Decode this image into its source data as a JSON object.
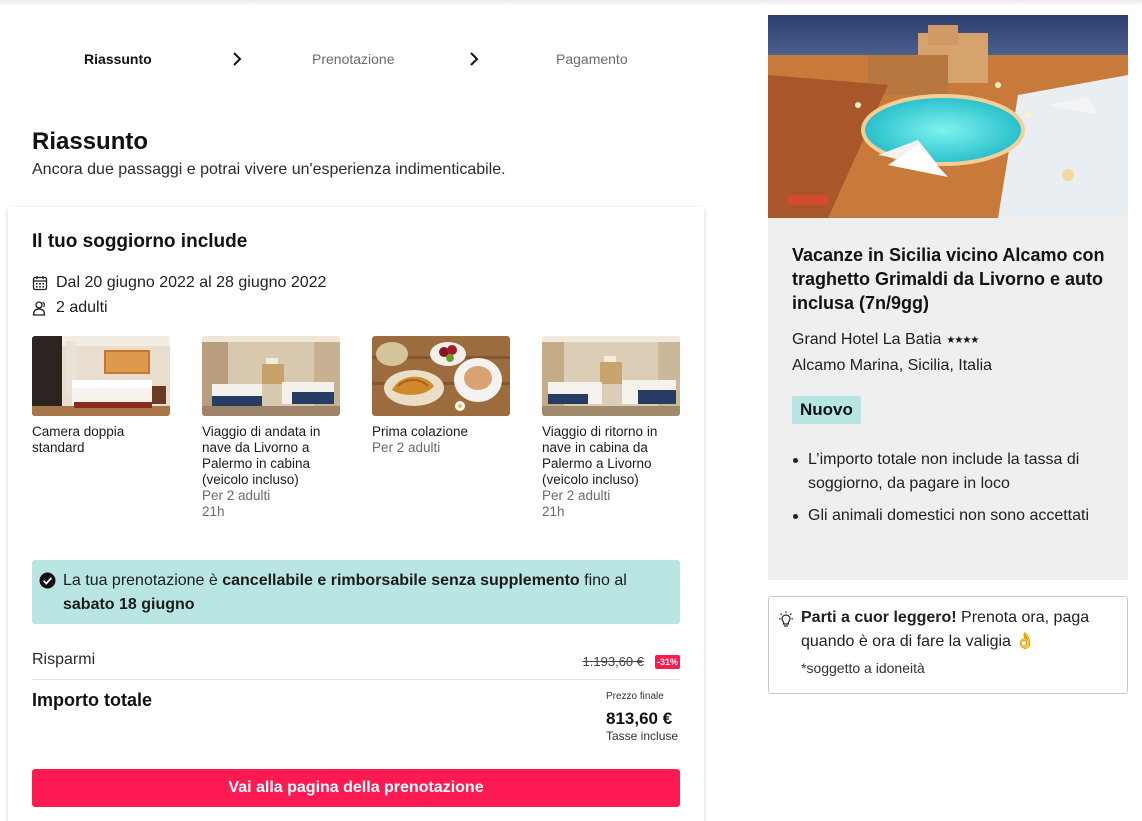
{
  "stepper": {
    "steps": [
      {
        "label": "Riassunto",
        "active": true
      },
      {
        "label": "Prenotazione",
        "active": false
      },
      {
        "label": "Pagamento",
        "active": false
      }
    ]
  },
  "header": {
    "title": "Riassunto",
    "subtitle": "Ancora due passaggi e potrai vivere un'esperienza indimenticabile."
  },
  "stay": {
    "title": "Il tuo soggiorno include",
    "dates": "Dal 20 giugno 2022 al 28 giugno 2022",
    "guests": "2 adulti",
    "items": [
      {
        "title": "Camera doppia standard",
        "sub": []
      },
      {
        "title": "Viaggio di andata in nave da Livorno a Palermo in cabina (veicolo incluso)",
        "sub": [
          "Per 2 adulti",
          "21h"
        ]
      },
      {
        "title": "Prima colazione",
        "sub": [
          "Per 2 adulti"
        ]
      },
      {
        "title": "Viaggio di ritorno in nave in cabina da Palermo a Livorno (veicolo incluso)",
        "sub": [
          "Per 2 adulti",
          "21h"
        ]
      }
    ]
  },
  "notice": {
    "prefix": "La tua prenotazione è ",
    "bold1": "cancellabile e rimborsabile senza supplemento",
    "middle": " fino al ",
    "bold2": "sabato 18 giugno"
  },
  "pricing": {
    "savings_label": "Risparmi",
    "old_price": "1.193,60 €",
    "discount": "-31%",
    "total_label": "Importo totale",
    "final_caption": "Prezzo finale",
    "final_price": "813,60 €",
    "tax_note": "Tasse incluse"
  },
  "cta": {
    "label": "Vai alla pagina della prenotazione"
  },
  "hotel": {
    "title": "Vacanze in Sicilia vicino Alcamo con traghetto Grimaldi da Livorno e auto inclusa (7n/9gg)",
    "name": "Grand Hotel La Batia",
    "stars": "★★★★",
    "rating": 4,
    "location": "Alcamo Marina, Sicilia, Italia",
    "badge": "Nuovo",
    "notes": [
      "L’importo totale non include la tassa di soggiorno, da pagare in loco",
      "Gli animali domestici non sono accettati"
    ]
  },
  "promo": {
    "bold": "Parti a cuor leggero!",
    "text": " Prenota ora, paga quando è ora di fare la valigia 👌",
    "note": "*soggetto a idoneità"
  },
  "colors": {
    "accent": "#ff1a54",
    "notice_bg": "#b9e6e3",
    "badge_bg": "#b7e5e1",
    "panel_bg": "#efeff0"
  }
}
